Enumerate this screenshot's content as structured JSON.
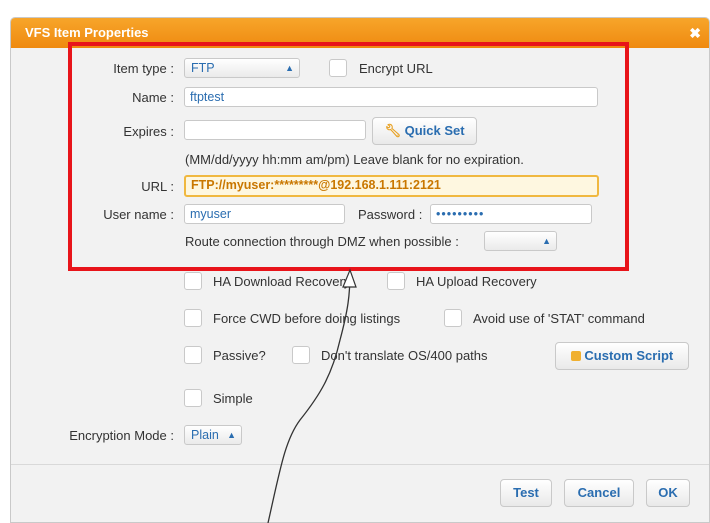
{
  "dialog": {
    "title": "VFS Item Properties",
    "close_glyph": "✖"
  },
  "form": {
    "item_type_label": "Item type :",
    "item_type_value": "FTP",
    "encrypt_url_label": "Encrypt URL",
    "name_label": "Name :",
    "name_value": "ftptest",
    "expires_label": "Expires :",
    "expires_value": "",
    "quick_set_label": "Quick Set",
    "expires_hint": "(MM/dd/yyyy hh:mm am/pm) Leave blank for no expiration.",
    "url_label": "URL :",
    "url_value": "FTP://myuser:*********@192.168.1.111:2121",
    "username_label": "User name :",
    "username_value": "myuser",
    "password_label": "Password :",
    "password_value": "•••••••••",
    "dmz_label": "Route connection through DMZ when possible :",
    "dmz_value": "",
    "ha_download_label": "HA Download Recovery",
    "ha_upload_label": "HA Upload Recovery",
    "force_cwd_label": "Force CWD before doing listings",
    "avoid_stat_label": "Avoid use of 'STAT' command",
    "passive_label": "Passive?",
    "dont_translate_label": "Don't translate OS/400 paths",
    "custom_script_label": "Custom Script",
    "simple_label": "Simple",
    "encryption_mode_label": "Encryption Mode :",
    "encryption_mode_value": "Plain"
  },
  "footer": {
    "test_label": "Test",
    "cancel_label": "Cancel",
    "ok_label": "OK"
  },
  "colors": {
    "title_bar": "#f09a1c",
    "link_blue": "#2a6db0",
    "highlight_red": "#e8141a"
  },
  "icons": {
    "quick_set": "wrench-icon",
    "custom_script": "script-icon",
    "select_arrows": "up-down-arrows-icon"
  }
}
